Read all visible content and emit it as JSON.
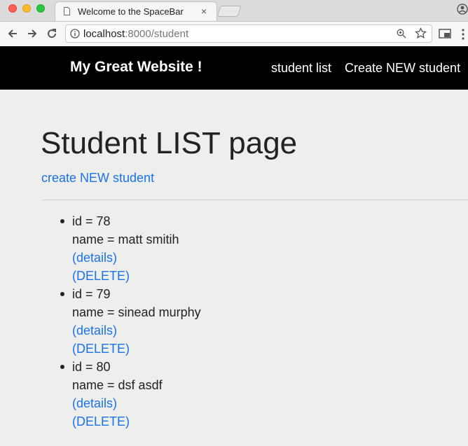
{
  "browser": {
    "tab_title": "Welcome to the SpaceBar",
    "tab_close": "×",
    "url_host": "localhost",
    "url_path": ":8000/student"
  },
  "site": {
    "brand": "My Great Website !",
    "nav": [
      {
        "label": "student list"
      },
      {
        "label": "Create NEW student"
      }
    ]
  },
  "page": {
    "title": "Student LIST page",
    "create_link": "create NEW student"
  },
  "students": [
    {
      "id_text": "id = 78",
      "name_text": "name = matt smitih",
      "details_label": "(details)",
      "delete_label": "(DELETE)"
    },
    {
      "id_text": "id = 79",
      "name_text": "name = sinead murphy",
      "details_label": "(details)",
      "delete_label": "(DELETE)"
    },
    {
      "id_text": "id = 80",
      "name_text": "name = dsf asdf",
      "details_label": "(details)",
      "delete_label": "(DELETE)"
    }
  ],
  "colors": {
    "link": "#1a73e8",
    "nav_bg": "#000000",
    "page_bg": "#eeeeec"
  }
}
